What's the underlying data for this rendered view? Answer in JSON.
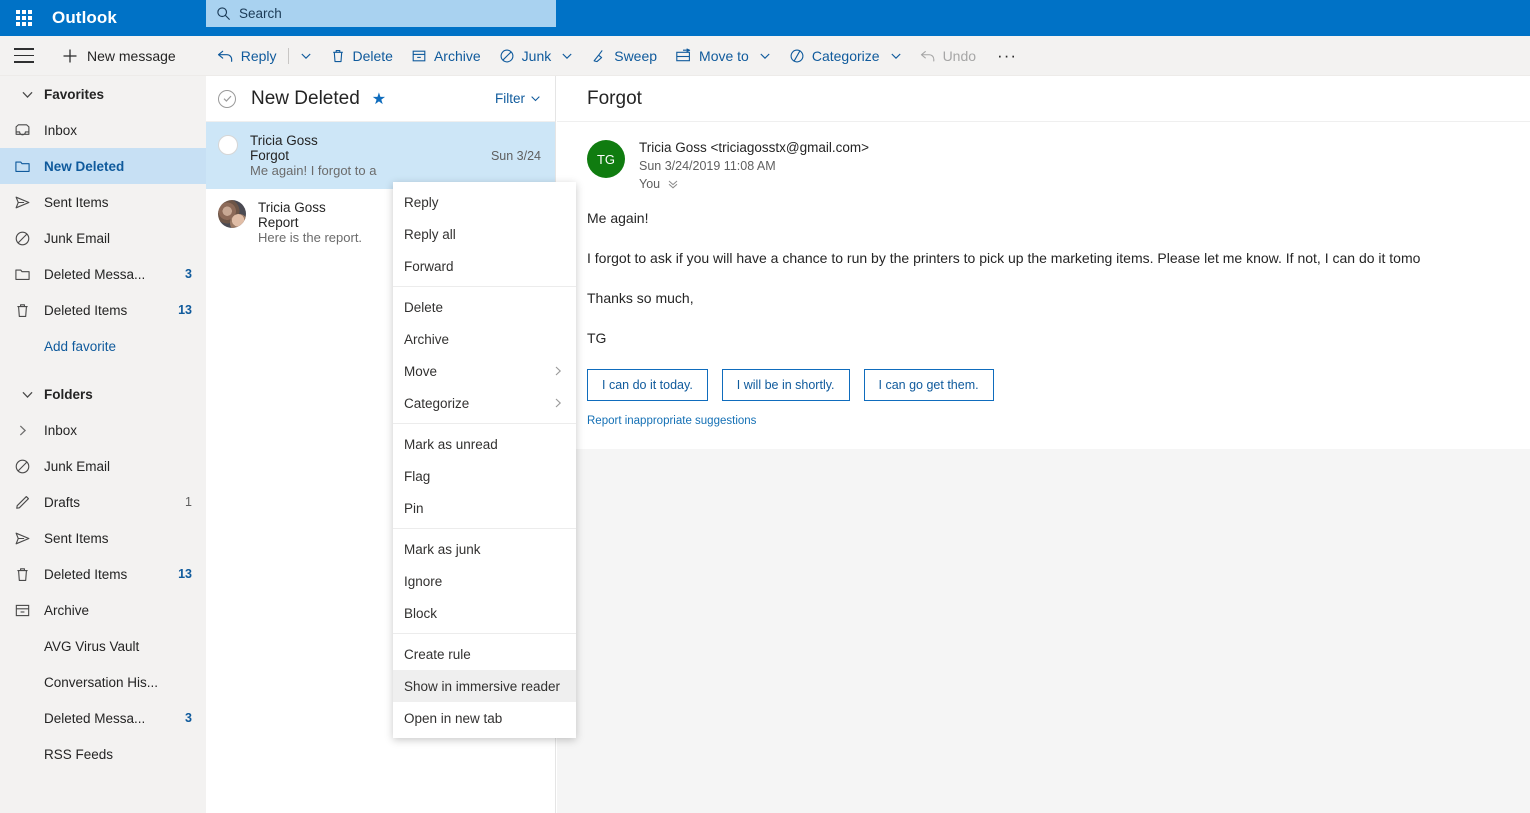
{
  "topbar": {
    "waffle_icon": "app-launcher-icon",
    "brand": "Outlook",
    "search": {
      "placeholder": "Search",
      "value": "",
      "icon": "search-icon"
    }
  },
  "commandbar": {
    "menu_icon": "hamburger-icon",
    "new_message": "New message",
    "items": [
      {
        "label": "Reply",
        "icon": "reply-icon",
        "has_split": true,
        "disabled": false
      },
      {
        "label": "Delete",
        "icon": "trash-icon",
        "has_chevron": false,
        "disabled": false
      },
      {
        "label": "Archive",
        "icon": "archive-box-icon",
        "has_chevron": false,
        "disabled": false
      },
      {
        "label": "Junk",
        "icon": "block-circle-icon",
        "has_chevron": true,
        "disabled": false
      },
      {
        "label": "Sweep",
        "icon": "broom-icon",
        "has_chevron": false,
        "disabled": false
      },
      {
        "label": "Move to",
        "icon": "move-folder-icon",
        "has_chevron": true,
        "disabled": false
      },
      {
        "label": "Categorize",
        "icon": "tag-icon",
        "has_chevron": true,
        "disabled": false
      },
      {
        "label": "Undo",
        "icon": "undo-icon",
        "has_chevron": false,
        "disabled": true
      }
    ],
    "overflow": "···"
  },
  "sidebar": {
    "favorites": {
      "label": "Favorites",
      "expanded": true
    },
    "favorite_items": [
      {
        "label": "Inbox",
        "icon": "inbox-icon",
        "count": "",
        "selected": false
      },
      {
        "label": "New Deleted",
        "icon": "folder-icon",
        "count": "",
        "selected": true
      },
      {
        "label": "Sent Items",
        "icon": "send-icon",
        "count": "",
        "selected": false
      },
      {
        "label": "Junk Email",
        "icon": "block-circle-icon",
        "count": "",
        "selected": false
      },
      {
        "label": "Deleted Messa...",
        "icon": "folder-icon",
        "count": "3",
        "selected": false
      },
      {
        "label": "Deleted Items",
        "icon": "trash-icon",
        "count": "13",
        "selected": false
      }
    ],
    "add_favorite": "Add favorite",
    "folders": {
      "label": "Folders",
      "expanded": true
    },
    "folder_items": [
      {
        "label": "Inbox",
        "icon": "chevron-right-icon",
        "count": ""
      },
      {
        "label": "Junk Email",
        "icon": "block-circle-icon",
        "count": ""
      },
      {
        "label": "Drafts",
        "icon": "pencil-icon",
        "count": "1"
      },
      {
        "label": "Sent Items",
        "icon": "send-icon",
        "count": ""
      },
      {
        "label": "Deleted Items",
        "icon": "trash-icon",
        "count": "13"
      },
      {
        "label": "Archive",
        "icon": "archive-box-icon",
        "count": ""
      },
      {
        "label": "AVG Virus Vault",
        "icon": "",
        "count": ""
      },
      {
        "label": "Conversation His...",
        "icon": "",
        "count": ""
      },
      {
        "label": "Deleted Messa...",
        "icon": "",
        "count": "3"
      },
      {
        "label": "RSS Feeds",
        "icon": "",
        "count": ""
      }
    ]
  },
  "messagelist": {
    "select_all_icon": "circle-check-icon",
    "title": "New Deleted",
    "star_icon": "star-icon",
    "filter": "Filter",
    "messages": [
      {
        "from": "Tricia Goss",
        "subject": "Forgot",
        "preview": "Me again! I forgot to a",
        "date": "Sun 3/24",
        "selected": true,
        "avatar_type": "unread-dot"
      },
      {
        "from": "Tricia Goss",
        "subject": "Report",
        "preview": "Here is the report.",
        "date": "",
        "selected": false,
        "avatar_type": "photo"
      }
    ]
  },
  "contextmenu": {
    "groups": [
      [
        {
          "label": "Reply",
          "submenu": false,
          "highlight": false
        },
        {
          "label": "Reply all",
          "submenu": false,
          "highlight": false
        },
        {
          "label": "Forward",
          "submenu": false,
          "highlight": false
        }
      ],
      [
        {
          "label": "Delete",
          "submenu": false,
          "highlight": false
        },
        {
          "label": "Archive",
          "submenu": false,
          "highlight": false
        },
        {
          "label": "Move",
          "submenu": true,
          "highlight": false
        },
        {
          "label": "Categorize",
          "submenu": true,
          "highlight": false
        }
      ],
      [
        {
          "label": "Mark as unread",
          "submenu": false,
          "highlight": false
        },
        {
          "label": "Flag",
          "submenu": false,
          "highlight": false
        },
        {
          "label": "Pin",
          "submenu": false,
          "highlight": false
        }
      ],
      [
        {
          "label": "Mark as junk",
          "submenu": false,
          "highlight": false
        },
        {
          "label": "Ignore",
          "submenu": false,
          "highlight": false
        },
        {
          "label": "Block",
          "submenu": false,
          "highlight": false
        }
      ],
      [
        {
          "label": "Create rule",
          "submenu": false,
          "highlight": false
        },
        {
          "label": "Show in immersive reader",
          "submenu": false,
          "highlight": true
        },
        {
          "label": "Open in new tab",
          "submenu": false,
          "highlight": false
        }
      ]
    ]
  },
  "reading": {
    "subject": "Forgot",
    "sender_initials": "TG",
    "sender_avatar_color": "#107c10",
    "sender_line": "Tricia Goss <triciagosstx@gmail.com>",
    "date_line": "Sun 3/24/2019 11:08 AM",
    "recipients": "You",
    "recipients_chevron_icon": "chevron-double-down-icon",
    "body": [
      "Me again!",
      "I forgot to ask if you will have a chance to run by the printers to pick up the marketing items. Please let me know. If not, I can do it tomo",
      "Thanks so much,",
      "TG"
    ],
    "suggested_replies": [
      "I can do it today.",
      "I will be in shortly.",
      "I can go get them."
    ],
    "report_link": "Report inappropriate suggestions"
  },
  "colors": {
    "brand_blue": "#0072c6",
    "accent_link": "#0f5a9c",
    "selection_blue": "#cde6f7",
    "nav_selection": "#c7e0f4",
    "chrome_gray": "#f3f2f1",
    "avatar_green": "#107c10"
  }
}
